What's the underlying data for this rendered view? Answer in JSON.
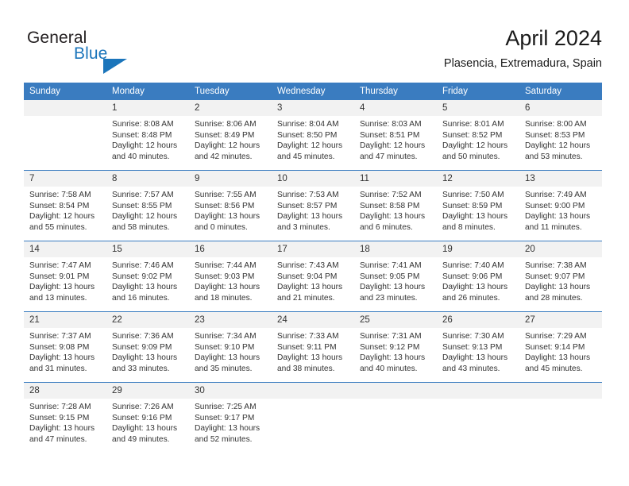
{
  "brand": {
    "line1": "General",
    "line2": "Blue",
    "accent_color": "#1b75bb",
    "triangle_icon": "triangle-logo-icon"
  },
  "header": {
    "month_title": "April 2024",
    "location": "Plasencia, Extremadura, Spain"
  },
  "calendar": {
    "header_bg": "#3a7cc0",
    "daynum_bg": "#f2f2f2",
    "weekday_headers": [
      "Sunday",
      "Monday",
      "Tuesday",
      "Wednesday",
      "Thursday",
      "Friday",
      "Saturday"
    ],
    "weeks": [
      [
        {
          "day": "",
          "sunrise": "",
          "sunset": "",
          "daylight1": "",
          "daylight2": ""
        },
        {
          "day": "1",
          "sunrise": "Sunrise: 8:08 AM",
          "sunset": "Sunset: 8:48 PM",
          "daylight1": "Daylight: 12 hours",
          "daylight2": "and 40 minutes."
        },
        {
          "day": "2",
          "sunrise": "Sunrise: 8:06 AM",
          "sunset": "Sunset: 8:49 PM",
          "daylight1": "Daylight: 12 hours",
          "daylight2": "and 42 minutes."
        },
        {
          "day": "3",
          "sunrise": "Sunrise: 8:04 AM",
          "sunset": "Sunset: 8:50 PM",
          "daylight1": "Daylight: 12 hours",
          "daylight2": "and 45 minutes."
        },
        {
          "day": "4",
          "sunrise": "Sunrise: 8:03 AM",
          "sunset": "Sunset: 8:51 PM",
          "daylight1": "Daylight: 12 hours",
          "daylight2": "and 47 minutes."
        },
        {
          "day": "5",
          "sunrise": "Sunrise: 8:01 AM",
          "sunset": "Sunset: 8:52 PM",
          "daylight1": "Daylight: 12 hours",
          "daylight2": "and 50 minutes."
        },
        {
          "day": "6",
          "sunrise": "Sunrise: 8:00 AM",
          "sunset": "Sunset: 8:53 PM",
          "daylight1": "Daylight: 12 hours",
          "daylight2": "and 53 minutes."
        }
      ],
      [
        {
          "day": "7",
          "sunrise": "Sunrise: 7:58 AM",
          "sunset": "Sunset: 8:54 PM",
          "daylight1": "Daylight: 12 hours",
          "daylight2": "and 55 minutes."
        },
        {
          "day": "8",
          "sunrise": "Sunrise: 7:57 AM",
          "sunset": "Sunset: 8:55 PM",
          "daylight1": "Daylight: 12 hours",
          "daylight2": "and 58 minutes."
        },
        {
          "day": "9",
          "sunrise": "Sunrise: 7:55 AM",
          "sunset": "Sunset: 8:56 PM",
          "daylight1": "Daylight: 13 hours",
          "daylight2": "and 0 minutes."
        },
        {
          "day": "10",
          "sunrise": "Sunrise: 7:53 AM",
          "sunset": "Sunset: 8:57 PM",
          "daylight1": "Daylight: 13 hours",
          "daylight2": "and 3 minutes."
        },
        {
          "day": "11",
          "sunrise": "Sunrise: 7:52 AM",
          "sunset": "Sunset: 8:58 PM",
          "daylight1": "Daylight: 13 hours",
          "daylight2": "and 6 minutes."
        },
        {
          "day": "12",
          "sunrise": "Sunrise: 7:50 AM",
          "sunset": "Sunset: 8:59 PM",
          "daylight1": "Daylight: 13 hours",
          "daylight2": "and 8 minutes."
        },
        {
          "day": "13",
          "sunrise": "Sunrise: 7:49 AM",
          "sunset": "Sunset: 9:00 PM",
          "daylight1": "Daylight: 13 hours",
          "daylight2": "and 11 minutes."
        }
      ],
      [
        {
          "day": "14",
          "sunrise": "Sunrise: 7:47 AM",
          "sunset": "Sunset: 9:01 PM",
          "daylight1": "Daylight: 13 hours",
          "daylight2": "and 13 minutes."
        },
        {
          "day": "15",
          "sunrise": "Sunrise: 7:46 AM",
          "sunset": "Sunset: 9:02 PM",
          "daylight1": "Daylight: 13 hours",
          "daylight2": "and 16 minutes."
        },
        {
          "day": "16",
          "sunrise": "Sunrise: 7:44 AM",
          "sunset": "Sunset: 9:03 PM",
          "daylight1": "Daylight: 13 hours",
          "daylight2": "and 18 minutes."
        },
        {
          "day": "17",
          "sunrise": "Sunrise: 7:43 AM",
          "sunset": "Sunset: 9:04 PM",
          "daylight1": "Daylight: 13 hours",
          "daylight2": "and 21 minutes."
        },
        {
          "day": "18",
          "sunrise": "Sunrise: 7:41 AM",
          "sunset": "Sunset: 9:05 PM",
          "daylight1": "Daylight: 13 hours",
          "daylight2": "and 23 minutes."
        },
        {
          "day": "19",
          "sunrise": "Sunrise: 7:40 AM",
          "sunset": "Sunset: 9:06 PM",
          "daylight1": "Daylight: 13 hours",
          "daylight2": "and 26 minutes."
        },
        {
          "day": "20",
          "sunrise": "Sunrise: 7:38 AM",
          "sunset": "Sunset: 9:07 PM",
          "daylight1": "Daylight: 13 hours",
          "daylight2": "and 28 minutes."
        }
      ],
      [
        {
          "day": "21",
          "sunrise": "Sunrise: 7:37 AM",
          "sunset": "Sunset: 9:08 PM",
          "daylight1": "Daylight: 13 hours",
          "daylight2": "and 31 minutes."
        },
        {
          "day": "22",
          "sunrise": "Sunrise: 7:36 AM",
          "sunset": "Sunset: 9:09 PM",
          "daylight1": "Daylight: 13 hours",
          "daylight2": "and 33 minutes."
        },
        {
          "day": "23",
          "sunrise": "Sunrise: 7:34 AM",
          "sunset": "Sunset: 9:10 PM",
          "daylight1": "Daylight: 13 hours",
          "daylight2": "and 35 minutes."
        },
        {
          "day": "24",
          "sunrise": "Sunrise: 7:33 AM",
          "sunset": "Sunset: 9:11 PM",
          "daylight1": "Daylight: 13 hours",
          "daylight2": "and 38 minutes."
        },
        {
          "day": "25",
          "sunrise": "Sunrise: 7:31 AM",
          "sunset": "Sunset: 9:12 PM",
          "daylight1": "Daylight: 13 hours",
          "daylight2": "and 40 minutes."
        },
        {
          "day": "26",
          "sunrise": "Sunrise: 7:30 AM",
          "sunset": "Sunset: 9:13 PM",
          "daylight1": "Daylight: 13 hours",
          "daylight2": "and 43 minutes."
        },
        {
          "day": "27",
          "sunrise": "Sunrise: 7:29 AM",
          "sunset": "Sunset: 9:14 PM",
          "daylight1": "Daylight: 13 hours",
          "daylight2": "and 45 minutes."
        }
      ],
      [
        {
          "day": "28",
          "sunrise": "Sunrise: 7:28 AM",
          "sunset": "Sunset: 9:15 PM",
          "daylight1": "Daylight: 13 hours",
          "daylight2": "and 47 minutes."
        },
        {
          "day": "29",
          "sunrise": "Sunrise: 7:26 AM",
          "sunset": "Sunset: 9:16 PM",
          "daylight1": "Daylight: 13 hours",
          "daylight2": "and 49 minutes."
        },
        {
          "day": "30",
          "sunrise": "Sunrise: 7:25 AM",
          "sunset": "Sunset: 9:17 PM",
          "daylight1": "Daylight: 13 hours",
          "daylight2": "and 52 minutes."
        },
        {
          "day": "",
          "sunrise": "",
          "sunset": "",
          "daylight1": "",
          "daylight2": ""
        },
        {
          "day": "",
          "sunrise": "",
          "sunset": "",
          "daylight1": "",
          "daylight2": ""
        },
        {
          "day": "",
          "sunrise": "",
          "sunset": "",
          "daylight1": "",
          "daylight2": ""
        },
        {
          "day": "",
          "sunrise": "",
          "sunset": "",
          "daylight1": "",
          "daylight2": ""
        }
      ]
    ]
  }
}
